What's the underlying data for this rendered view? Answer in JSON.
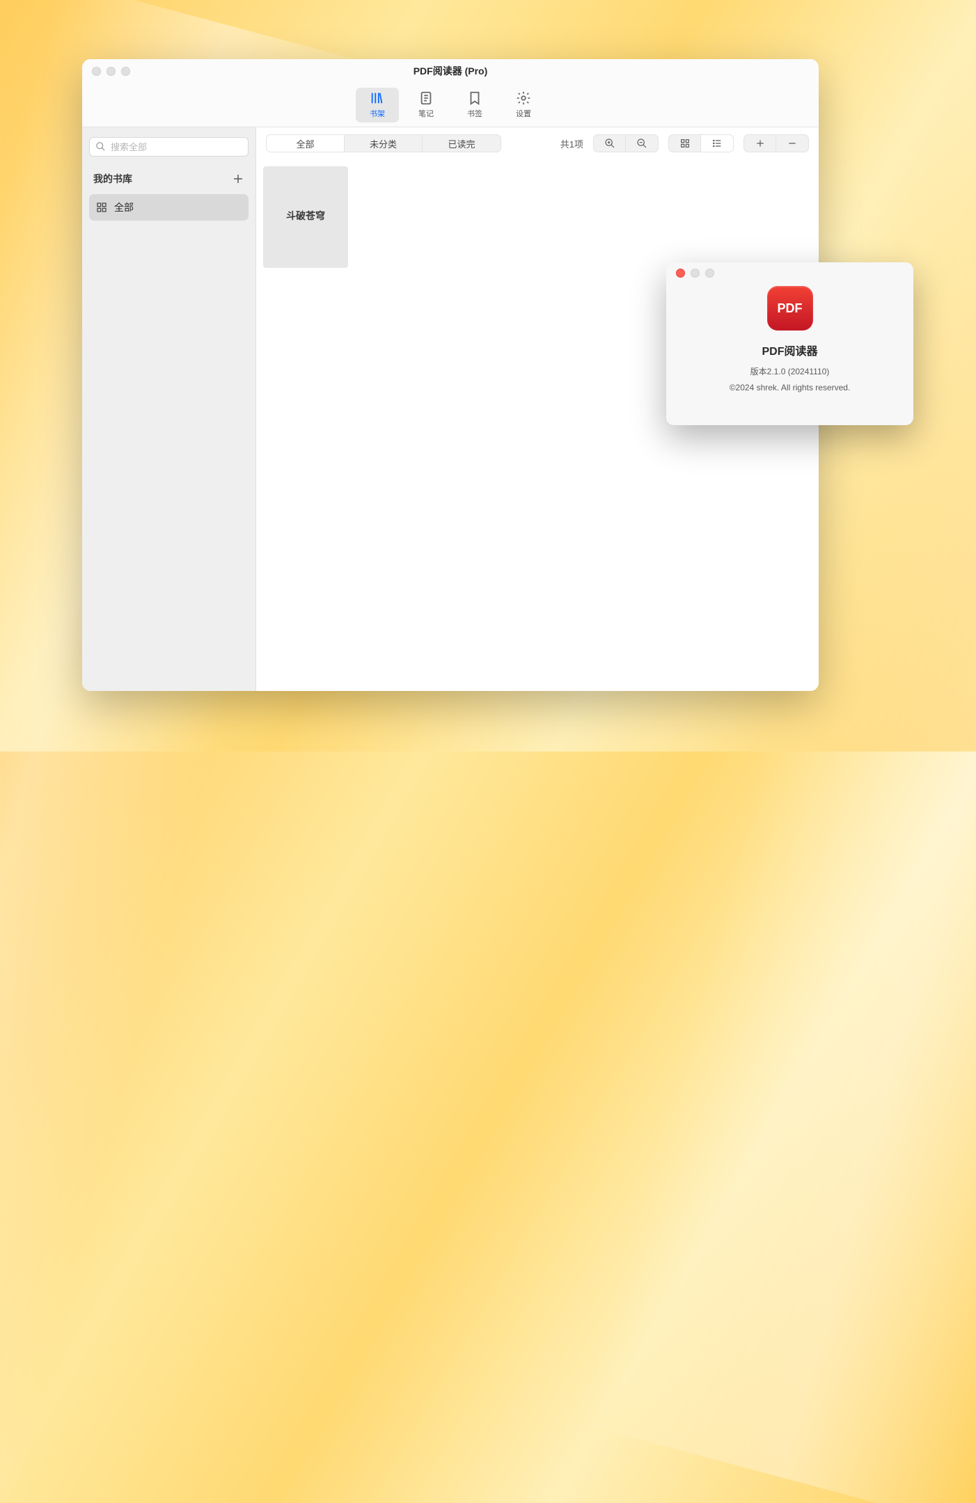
{
  "window": {
    "title": "PDF阅读器 (Pro)"
  },
  "toolbar": {
    "library": "书架",
    "notes": "笔记",
    "bookmarks": "书签",
    "settings": "设置"
  },
  "sidebar": {
    "search_placeholder": "搜索全部",
    "library_header": "我的书库",
    "items": [
      {
        "label": "全部"
      }
    ]
  },
  "filter": {
    "segments": {
      "all": "全部",
      "unsorted": "未分类",
      "finished": "已读完"
    },
    "count_label": "共1项"
  },
  "books": [
    {
      "title": "斗破苍穹"
    }
  ],
  "about": {
    "icon_text": "PDF",
    "app_name": "PDF阅读器",
    "version": "版本2.1.0 (20241110)",
    "copyright": "©2024 shrek. All rights reserved."
  }
}
